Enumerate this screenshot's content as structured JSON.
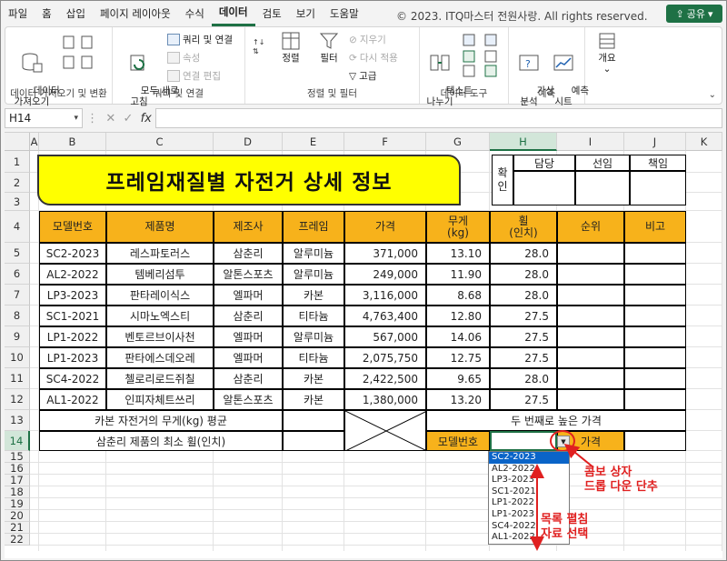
{
  "menu": {
    "tabs": [
      "파일",
      "홈",
      "삽입",
      "페이지 레이아웃",
      "수식",
      "데이터",
      "검토",
      "보기",
      "도움말"
    ],
    "active": "데이터",
    "copyright": "© 2023. ITQ마스터 전원사랑. All rights reserved.",
    "share_label": "공유"
  },
  "ribbon": {
    "get_data": {
      "label": "데이터\n가져오기",
      "group": "데이터 가져오기 및 변환"
    },
    "refresh_all": {
      "label": "모두 새로\n고침",
      "group": "쿼리 및 연결"
    },
    "query_conn": "쿼리 및 연결",
    "properties": "속성",
    "edit_links": "연결 편집",
    "sort": "정렬",
    "filter": "필터",
    "clear": "지우기",
    "reapply": "다시 적용",
    "advanced": "고급",
    "sort_filter_group": "정렬 및 필터",
    "text_to_columns": "텍스트\n나누기",
    "data_tools_group": "데이터 도구",
    "what_if": "가상\n분석",
    "forecast_sheet": "예측\n시트",
    "forecast_group": "예측",
    "outline": "개요"
  },
  "formula_bar": {
    "name_box": "H14",
    "fx": "fx",
    "value": ""
  },
  "columns": [
    "A",
    "B",
    "C",
    "D",
    "E",
    "F",
    "G",
    "H",
    "I",
    "J",
    "K"
  ],
  "rows": [
    "1",
    "2",
    "3",
    "4",
    "5",
    "6",
    "7",
    "8",
    "9",
    "10",
    "11",
    "12",
    "13",
    "14",
    "15",
    "16",
    "17",
    "18",
    "19",
    "20",
    "21",
    "22"
  ],
  "title": "프레임재질별 자전거 상세 정보",
  "approval": {
    "label": "확\n인",
    "cols": [
      "담당",
      "선임",
      "책임"
    ]
  },
  "table": {
    "headers": [
      "모델번호",
      "제품명",
      "제조사",
      "프레임",
      "가격",
      "무게\n(kg)",
      "휠\n(인치)",
      "순위",
      "비고"
    ],
    "rows": [
      [
        "SC2-2023",
        "레스파토러스",
        "삼춘리",
        "알루미늄",
        "371,000",
        "13.10",
        "28.0",
        "",
        ""
      ],
      [
        "AL2-2022",
        "템베리섬투",
        "알톤스포츠",
        "알루미늄",
        "249,000",
        "11.90",
        "28.0",
        "",
        ""
      ],
      [
        "LP3-2023",
        "판타레이식스",
        "엘파머",
        "카본",
        "3,116,000",
        "8.68",
        "28.0",
        "",
        ""
      ],
      [
        "SC1-2021",
        "시마노엑스티",
        "삼춘리",
        "티타늄",
        "4,763,400",
        "12.80",
        "27.5",
        "",
        ""
      ],
      [
        "LP1-2022",
        "벤토르브이사천",
        "엘파머",
        "알루미늄",
        "567,000",
        "14.06",
        "27.5",
        "",
        ""
      ],
      [
        "LP1-2023",
        "판타에스데오레",
        "엘파머",
        "티타늄",
        "2,075,750",
        "12.75",
        "27.5",
        "",
        ""
      ],
      [
        "SC4-2022",
        "첼로리로드쥐칠",
        "삼춘리",
        "카본",
        "2,422,500",
        "9.65",
        "28.0",
        "",
        ""
      ],
      [
        "AL1-2022",
        "인피자체트쓰리",
        "알톤스포츠",
        "카본",
        "1,380,000",
        "13.20",
        "27.5",
        "",
        ""
      ]
    ],
    "row13_label": "카본 자전거의 무게(kg) 평균",
    "row14_label": "삼춘리 제품의 최소 휠(인치)",
    "second_price_label": "두 번째로 높은 가격",
    "model_label": "모델번호",
    "price_label": "가격"
  },
  "dropdown": {
    "items": [
      "SC2-2023",
      "AL2-2022",
      "LP3-2023",
      "SC1-2021",
      "LP1-2022",
      "LP1-2023",
      "SC4-2022",
      "AL1-2022"
    ],
    "selected": "SC2-2023"
  },
  "annotations": {
    "combo": "콤보 상자\n드롭 다운 단추",
    "list": "목록 펼침\n자료 선택"
  },
  "colors": {
    "accent": "#1e7145",
    "header_fill": "#f7b21b",
    "title_fill": "#ffff00",
    "annotation": "#e02020",
    "selected_item": "#0a64c8"
  }
}
